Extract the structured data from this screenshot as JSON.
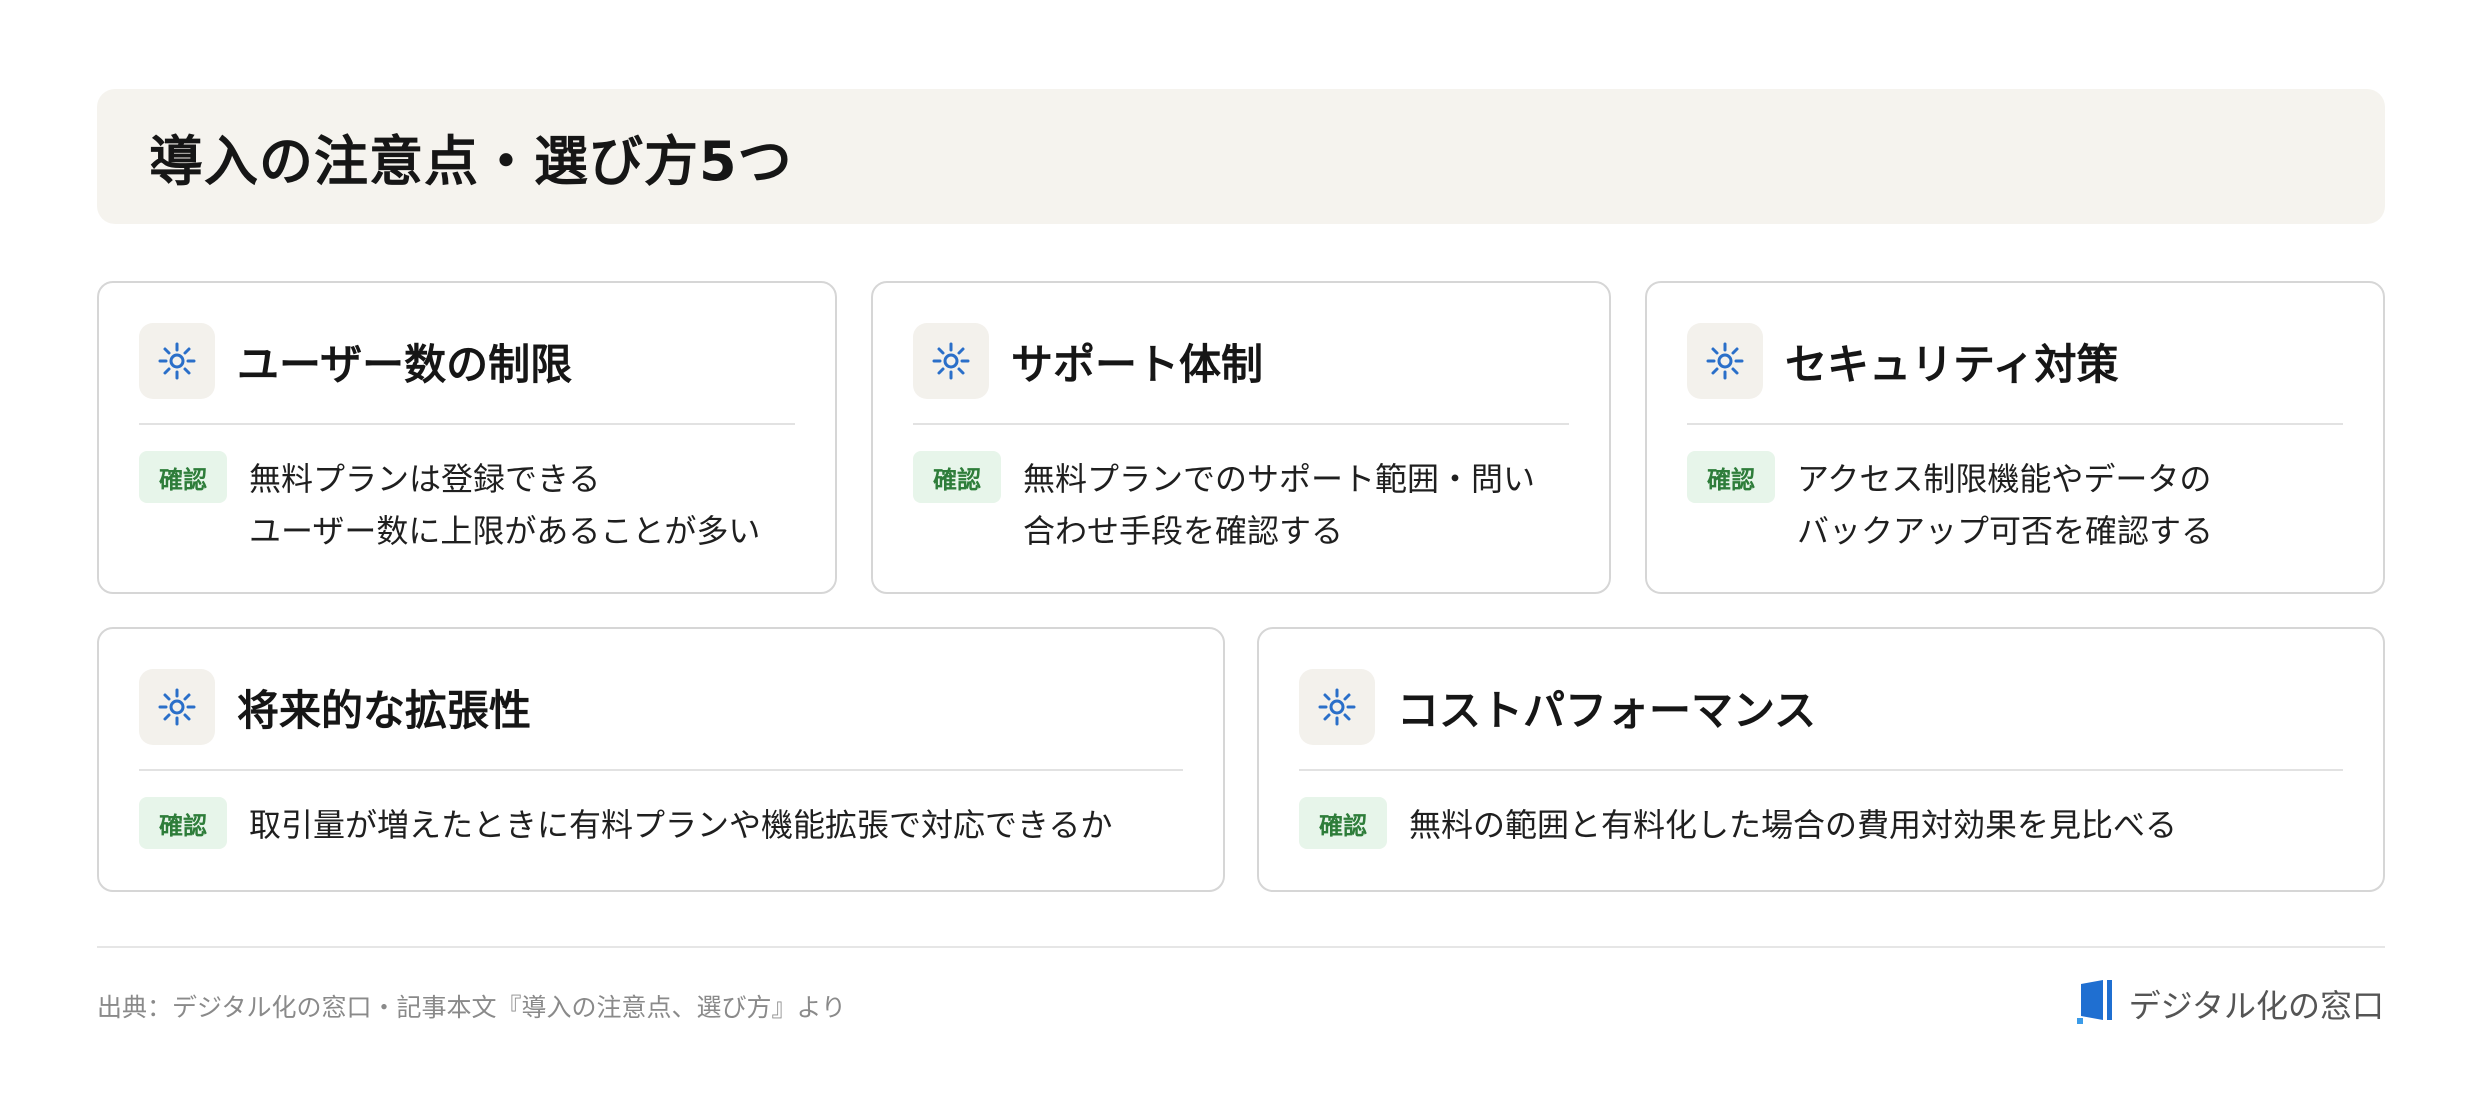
{
  "title": "導入の注意点・選び方5つ",
  "badge_label": "確認",
  "icon_name": "sun-icon",
  "colors": {
    "icon_blue": "#2a6fc9",
    "badge_bg": "#e7f5ea",
    "badge_text": "#2e7d3a",
    "header_bg": "#f5f3ee",
    "logo_blue": "#1f6fd1"
  },
  "cards": [
    {
      "title": "ユーザー数の制限",
      "lines": [
        "無料プランは登録できる",
        "ユーザー数に上限があることが多い"
      ]
    },
    {
      "title": "サポート体制",
      "lines": [
        "無料プランでのサポート範囲・問い",
        "合わせ手段を確認する"
      ]
    },
    {
      "title": "セキュリティ対策",
      "lines": [
        "アクセス制限機能やデータの",
        "バックアップ可否を確認する"
      ]
    },
    {
      "title": "将来的な拡張性",
      "lines": [
        "取引量が増えたときに有料プランや機能拡張で対応できるか"
      ]
    },
    {
      "title": "コストパフォーマンス",
      "lines": [
        "無料の範囲と有料化した場合の費用対効果を見比べる"
      ]
    }
  ],
  "footer": {
    "source": "出典：デジタル化の窓口・記事本文『導入の注意点、選び方』より",
    "brand": "デジタル化の窓口"
  }
}
